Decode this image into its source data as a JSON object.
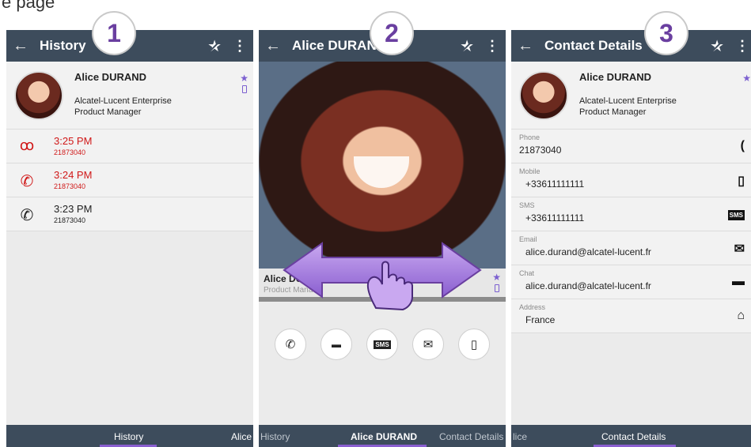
{
  "caption": "e page",
  "panels": [
    {
      "badge": "1",
      "appbar": {
        "title": "History"
      },
      "contact": {
        "name": "Alice DURAND",
        "company": "Alcatel-Lucent Enterprise",
        "role": "Product Manager"
      },
      "history": [
        {
          "time": "3:25 PM",
          "number": "21873040",
          "icon": "voicemail-icon",
          "glyph": "ꝏ"
        },
        {
          "time": "3:24 PM",
          "number": "21873040",
          "icon": "missed-call-icon",
          "glyph": "✆"
        },
        {
          "time": "3:23 PM",
          "number": "21873040",
          "icon": "incoming-call-icon",
          "glyph": "✆"
        }
      ],
      "tabs": {
        "left": "History",
        "right": "Alice"
      }
    },
    {
      "badge": "2",
      "appbar": {
        "title": "Alice DURAN"
      },
      "contact": {
        "name": "Alice DU",
        "role": "Product Mana"
      },
      "actions": [
        {
          "icon": "phone-icon",
          "glyph": "✆"
        },
        {
          "icon": "chat-icon",
          "glyph": "▬"
        },
        {
          "icon": "sms-icon",
          "glyph": "SMS"
        },
        {
          "icon": "email-icon",
          "glyph": "✉"
        },
        {
          "icon": "mobile-icon",
          "glyph": "▯"
        }
      ],
      "tabs": {
        "left": "History",
        "center": "Alice DURAND",
        "right": "Contact Details"
      }
    },
    {
      "badge": "3",
      "appbar": {
        "title": "Contact Details"
      },
      "contact": {
        "name": "Alice DURAND",
        "company": "Alcatel-Lucent Enterprise",
        "role": "Product Manager"
      },
      "details": [
        {
          "label": "Phone",
          "value": "21873040",
          "icon": "phone-icon",
          "glyph": "("
        },
        {
          "label": "Mobile",
          "value": "+33611111111",
          "icon": "mobile-icon",
          "glyph": "▯"
        },
        {
          "label": "SMS",
          "value": "+33611111111",
          "icon": "sms-icon",
          "glyph": "SMS"
        },
        {
          "label": "Email",
          "value": "alice.durand@alcatel-lucent.fr",
          "icon": "email-icon",
          "glyph": "✉"
        },
        {
          "label": "Chat",
          "value": "alice.durand@alcatel-lucent.fr",
          "icon": "chat-icon",
          "glyph": "▬"
        },
        {
          "label": "Address",
          "value": "France",
          "icon": "home-icon",
          "glyph": "⌂"
        }
      ],
      "tabs": {
        "left": "lice",
        "center": "Contact Details"
      }
    }
  ],
  "colors": {
    "appbar": "#3d4c5c",
    "accent": "#8a5fd0",
    "missed": "#d01818"
  }
}
